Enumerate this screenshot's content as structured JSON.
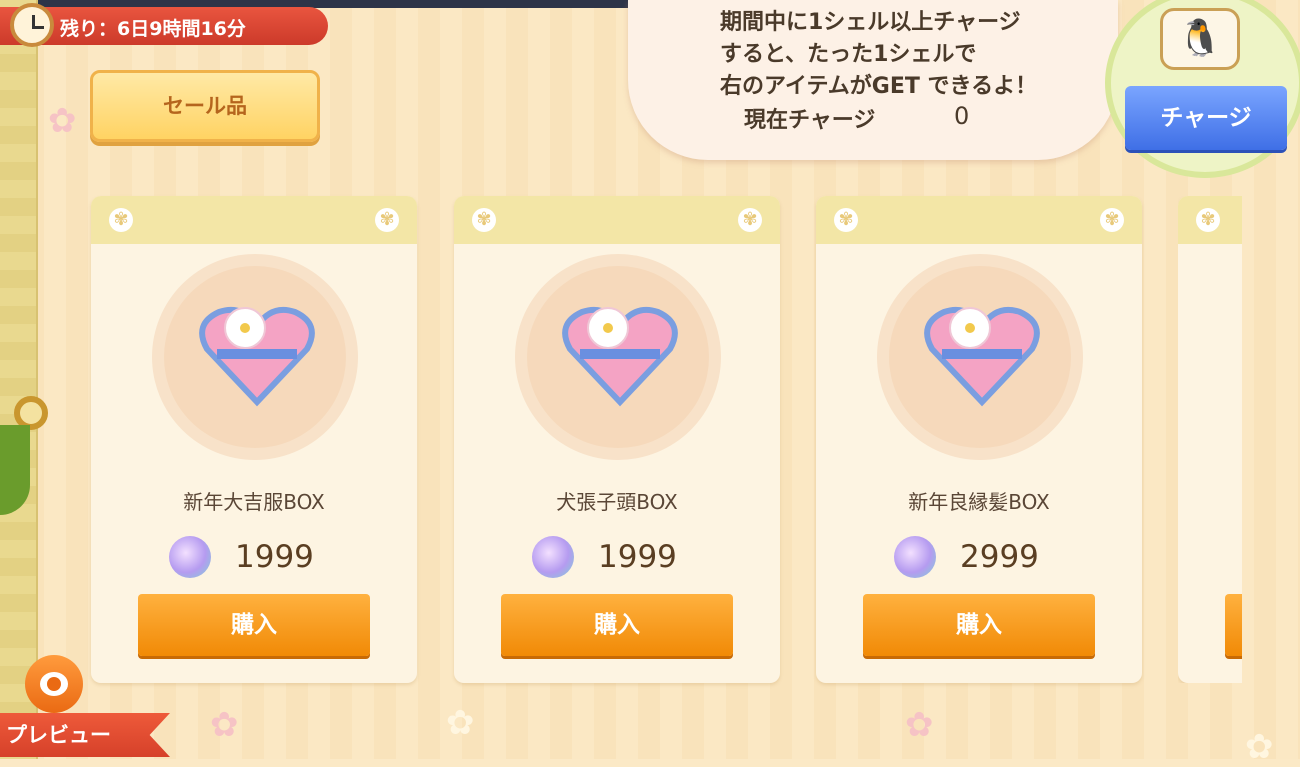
{
  "timer": {
    "text": "残り：6日9時間16分"
  },
  "sale_button": {
    "label": "セール品"
  },
  "campaign": {
    "line1": "期間中に1シェル以上チャージ",
    "line2": "すると、たった1シェルで",
    "line3": "右のアイテムがGET できるよ！",
    "current_label": "現在チャージ",
    "current_value": "0"
  },
  "charge_button": {
    "label": "チャージ"
  },
  "items": [
    {
      "name": "新年大吉服BOX",
      "price": "1999",
      "buy_label": "購入"
    },
    {
      "name": "犬張子頭BOX",
      "price": "1999",
      "buy_label": "購入"
    },
    {
      "name": "新年良縁髪BOX",
      "price": "2999",
      "buy_label": "購入"
    }
  ],
  "preview": {
    "label": "プレビュー"
  },
  "colors": {
    "buy": "#f18a06",
    "charge": "#3f6fe6",
    "timer": "#cc3a2a"
  }
}
